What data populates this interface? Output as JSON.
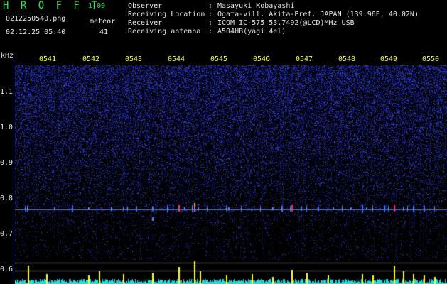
{
  "header": {
    "app_title": "H R O F F T",
    "version": "1.00",
    "file_name": "0212250540.png",
    "meteor_label": "meteor",
    "timestamp": "02.12.25 05:40",
    "meteor_count": "41"
  },
  "station_info": [
    {
      "key": "Observer",
      "value": "Masayuki Kobayashi"
    },
    {
      "key": "Receiving Location",
      "value": "Ogata-vill. Akita-Pref. JAPAN (139.96E, 40.02N)"
    },
    {
      "key": "Receiver",
      "value": "ICOM IC-575 53.7492(@LCD)MHz USB"
    },
    {
      "key": "Receiving antenna",
      "value": "A504HB(yagi 4el)"
    }
  ],
  "axes": {
    "y_unit": "kHz",
    "time_ticks": [
      "0541",
      "0542",
      "0543",
      "0544",
      "0545",
      "0546",
      "0547",
      "0548",
      "0549",
      "0550"
    ],
    "freq_ticks": [
      "1.1",
      "1.0",
      "0.9",
      "0.8",
      "0.7",
      "0.6"
    ]
  },
  "colors": {
    "title_green": "#2ee04a",
    "tick_yellow": "#ffff33",
    "background_noise": "#1a1aa0",
    "echo_red": "#ff3030",
    "activity_yellow": "#ffff33",
    "activity_cyan": "#22dddd"
  }
}
